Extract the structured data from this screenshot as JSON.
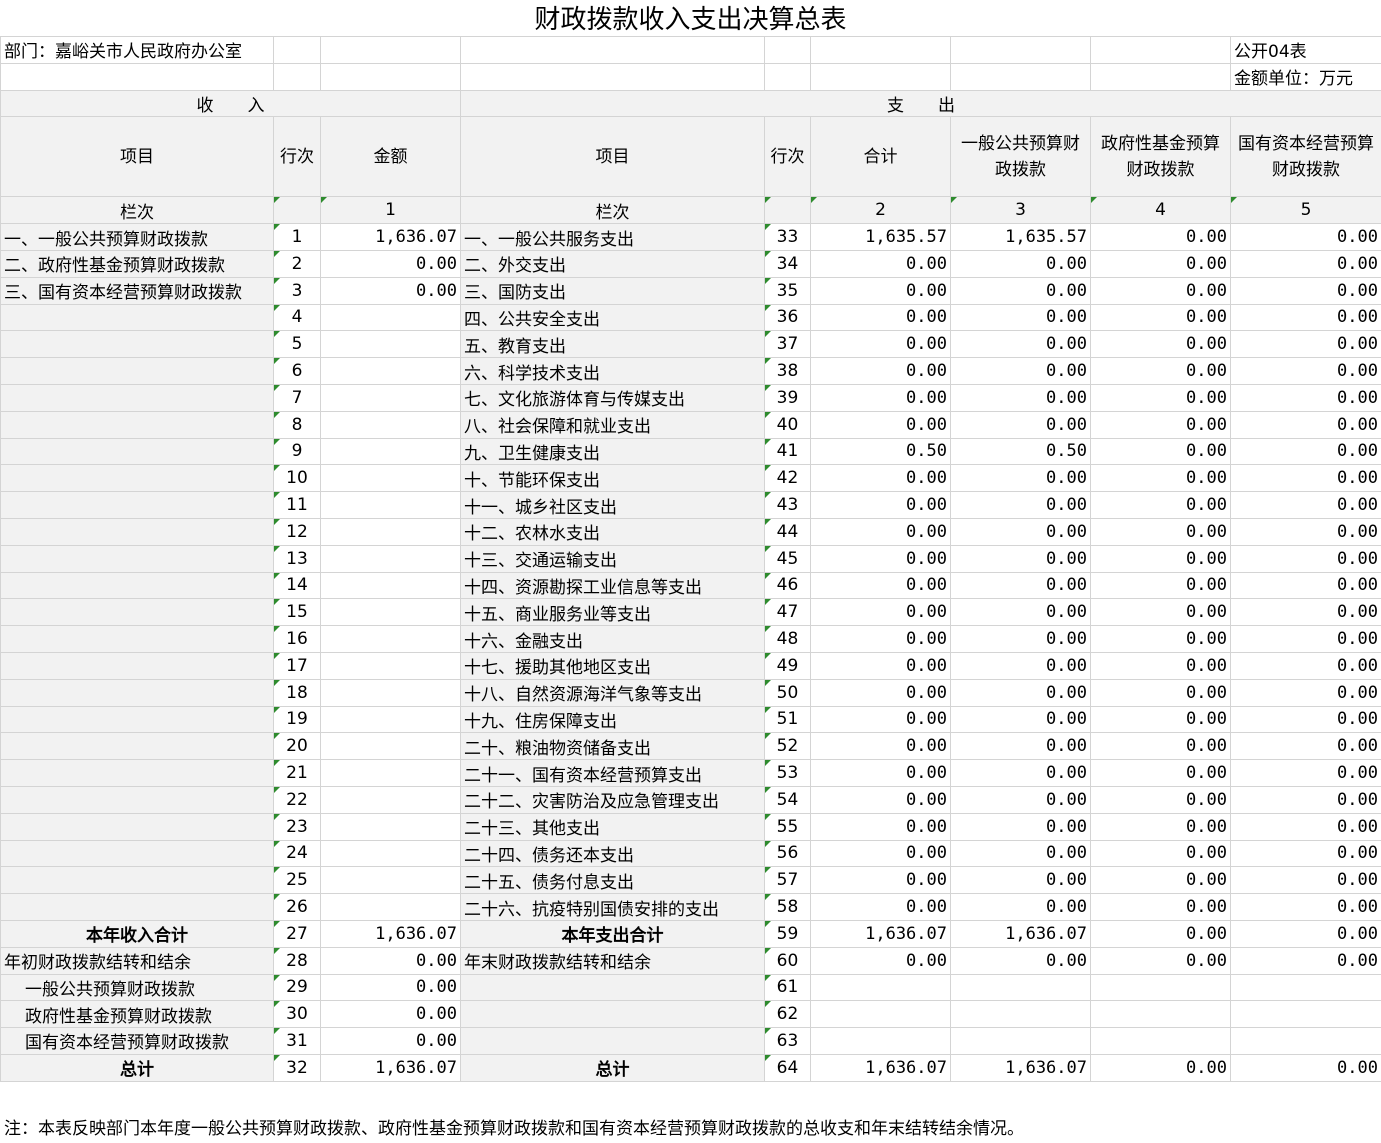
{
  "title": "财政拨款收入支出决算总表",
  "meta": {
    "department": "部门：嘉峪关市人民政府办公室",
    "table_no": "公开04表",
    "unit": "金额单位：万元"
  },
  "headers": {
    "income": "收　　入",
    "expense": "支　　出",
    "item": "项目",
    "row_no": "行次",
    "amount": "金额",
    "total": "合计",
    "general": "一般公共预算财政拨款",
    "fund": "政府性基金预算财政拨款",
    "state_capital": "国有资本经营预算财政拨款",
    "col_label": "栏次",
    "col1": "1",
    "col2": "2",
    "col3": "3",
    "col4": "4",
    "col5": "5"
  },
  "rows": [
    {
      "in_item": "一、一般公共预算财政拨款",
      "in_no": "1",
      "in_amt": "1,636.07",
      "ex_item": "一、一般公共服务支出",
      "ex_no": "33",
      "t": "1,635.57",
      "g": "1,635.57",
      "f": "0.00",
      "s": "0.00"
    },
    {
      "in_item": "二、政府性基金预算财政拨款",
      "in_no": "2",
      "in_amt": "0.00",
      "ex_item": "二、外交支出",
      "ex_no": "34",
      "t": "0.00",
      "g": "0.00",
      "f": "0.00",
      "s": "0.00"
    },
    {
      "in_item": "三、国有资本经营预算财政拨款",
      "in_no": "3",
      "in_amt": "0.00",
      "ex_item": "三、国防支出",
      "ex_no": "35",
      "t": "0.00",
      "g": "0.00",
      "f": "0.00",
      "s": "0.00"
    },
    {
      "in_item": "",
      "in_no": "4",
      "in_amt": "",
      "ex_item": "四、公共安全支出",
      "ex_no": "36",
      "t": "0.00",
      "g": "0.00",
      "f": "0.00",
      "s": "0.00"
    },
    {
      "in_item": "",
      "in_no": "5",
      "in_amt": "",
      "ex_item": "五、教育支出",
      "ex_no": "37",
      "t": "0.00",
      "g": "0.00",
      "f": "0.00",
      "s": "0.00"
    },
    {
      "in_item": "",
      "in_no": "6",
      "in_amt": "",
      "ex_item": "六、科学技术支出",
      "ex_no": "38",
      "t": "0.00",
      "g": "0.00",
      "f": "0.00",
      "s": "0.00"
    },
    {
      "in_item": "",
      "in_no": "7",
      "in_amt": "",
      "ex_item": "七、文化旅游体育与传媒支出",
      "ex_no": "39",
      "t": "0.00",
      "g": "0.00",
      "f": "0.00",
      "s": "0.00"
    },
    {
      "in_item": "",
      "in_no": "8",
      "in_amt": "",
      "ex_item": "八、社会保障和就业支出",
      "ex_no": "40",
      "t": "0.00",
      "g": "0.00",
      "f": "0.00",
      "s": "0.00"
    },
    {
      "in_item": "",
      "in_no": "9",
      "in_amt": "",
      "ex_item": "九、卫生健康支出",
      "ex_no": "41",
      "t": "0.50",
      "g": "0.50",
      "f": "0.00",
      "s": "0.00"
    },
    {
      "in_item": "",
      "in_no": "10",
      "in_amt": "",
      "ex_item": "十、节能环保支出",
      "ex_no": "42",
      "t": "0.00",
      "g": "0.00",
      "f": "0.00",
      "s": "0.00"
    },
    {
      "in_item": "",
      "in_no": "11",
      "in_amt": "",
      "ex_item": "十一、城乡社区支出",
      "ex_no": "43",
      "t": "0.00",
      "g": "0.00",
      "f": "0.00",
      "s": "0.00"
    },
    {
      "in_item": "",
      "in_no": "12",
      "in_amt": "",
      "ex_item": "十二、农林水支出",
      "ex_no": "44",
      "t": "0.00",
      "g": "0.00",
      "f": "0.00",
      "s": "0.00"
    },
    {
      "in_item": "",
      "in_no": "13",
      "in_amt": "",
      "ex_item": "十三、交通运输支出",
      "ex_no": "45",
      "t": "0.00",
      "g": "0.00",
      "f": "0.00",
      "s": "0.00"
    },
    {
      "in_item": "",
      "in_no": "14",
      "in_amt": "",
      "ex_item": "十四、资源勘探工业信息等支出",
      "ex_no": "46",
      "t": "0.00",
      "g": "0.00",
      "f": "0.00",
      "s": "0.00"
    },
    {
      "in_item": "",
      "in_no": "15",
      "in_amt": "",
      "ex_item": "十五、商业服务业等支出",
      "ex_no": "47",
      "t": "0.00",
      "g": "0.00",
      "f": "0.00",
      "s": "0.00"
    },
    {
      "in_item": "",
      "in_no": "16",
      "in_amt": "",
      "ex_item": "十六、金融支出",
      "ex_no": "48",
      "t": "0.00",
      "g": "0.00",
      "f": "0.00",
      "s": "0.00"
    },
    {
      "in_item": "",
      "in_no": "17",
      "in_amt": "",
      "ex_item": "十七、援助其他地区支出",
      "ex_no": "49",
      "t": "0.00",
      "g": "0.00",
      "f": "0.00",
      "s": "0.00"
    },
    {
      "in_item": "",
      "in_no": "18",
      "in_amt": "",
      "ex_item": "十八、自然资源海洋气象等支出",
      "ex_no": "50",
      "t": "0.00",
      "g": "0.00",
      "f": "0.00",
      "s": "0.00"
    },
    {
      "in_item": "",
      "in_no": "19",
      "in_amt": "",
      "ex_item": "十九、住房保障支出",
      "ex_no": "51",
      "t": "0.00",
      "g": "0.00",
      "f": "0.00",
      "s": "0.00"
    },
    {
      "in_item": "",
      "in_no": "20",
      "in_amt": "",
      "ex_item": "二十、粮油物资储备支出",
      "ex_no": "52",
      "t": "0.00",
      "g": "0.00",
      "f": "0.00",
      "s": "0.00"
    },
    {
      "in_item": "",
      "in_no": "21",
      "in_amt": "",
      "ex_item": "二十一、国有资本经营预算支出",
      "ex_no": "53",
      "t": "0.00",
      "g": "0.00",
      "f": "0.00",
      "s": "0.00"
    },
    {
      "in_item": "",
      "in_no": "22",
      "in_amt": "",
      "ex_item": "二十二、灾害防治及应急管理支出",
      "ex_no": "54",
      "t": "0.00",
      "g": "0.00",
      "f": "0.00",
      "s": "0.00"
    },
    {
      "in_item": "",
      "in_no": "23",
      "in_amt": "",
      "ex_item": "二十三、其他支出",
      "ex_no": "55",
      "t": "0.00",
      "g": "0.00",
      "f": "0.00",
      "s": "0.00"
    },
    {
      "in_item": "",
      "in_no": "24",
      "in_amt": "",
      "ex_item": "二十四、债务还本支出",
      "ex_no": "56",
      "t": "0.00",
      "g": "0.00",
      "f": "0.00",
      "s": "0.00"
    },
    {
      "in_item": "",
      "in_no": "25",
      "in_amt": "",
      "ex_item": "二十五、债务付息支出",
      "ex_no": "57",
      "t": "0.00",
      "g": "0.00",
      "f": "0.00",
      "s": "0.00"
    },
    {
      "in_item": "",
      "in_no": "26",
      "in_amt": "",
      "ex_item": "二十六、抗疫特别国债安排的支出",
      "ex_no": "58",
      "t": "0.00",
      "g": "0.00",
      "f": "0.00",
      "s": "0.00"
    },
    {
      "in_item": "本年收入合计",
      "in_no": "27",
      "in_amt": "1,636.07",
      "ex_item": "本年支出合计",
      "ex_no": "59",
      "t": "1,636.07",
      "g": "1,636.07",
      "f": "0.00",
      "s": "0.00",
      "bold": true
    },
    {
      "in_item": "年初财政拨款结转和结余",
      "in_no": "28",
      "in_amt": "0.00",
      "ex_item": "年末财政拨款结转和结余",
      "ex_no": "60",
      "t": "0.00",
      "g": "0.00",
      "f": "0.00",
      "s": "0.00"
    },
    {
      "in_item": "一般公共预算财政拨款",
      "in_no": "29",
      "in_amt": "0.00",
      "ex_item": "",
      "ex_no": "61",
      "t": "",
      "g": "",
      "f": "",
      "s": "",
      "indent": true
    },
    {
      "in_item": "政府性基金预算财政拨款",
      "in_no": "30",
      "in_amt": "0.00",
      "ex_item": "",
      "ex_no": "62",
      "t": "",
      "g": "",
      "f": "",
      "s": "",
      "indent": true
    },
    {
      "in_item": "国有资本经营预算财政拨款",
      "in_no": "31",
      "in_amt": "0.00",
      "ex_item": "",
      "ex_no": "63",
      "t": "",
      "g": "",
      "f": "",
      "s": "",
      "indent": true
    },
    {
      "in_item": "总计",
      "in_no": "32",
      "in_amt": "1,636.07",
      "ex_item": "总计",
      "ex_no": "64",
      "t": "1,636.07",
      "g": "1,636.07",
      "f": "0.00",
      "s": "0.00",
      "bold": true
    }
  ],
  "note": "注：本表反映部门本年度一般公共预算财政拨款、政府性基金预算财政拨款和国有资本经营预算财政拨款的总收支和年末结转结余情况。"
}
